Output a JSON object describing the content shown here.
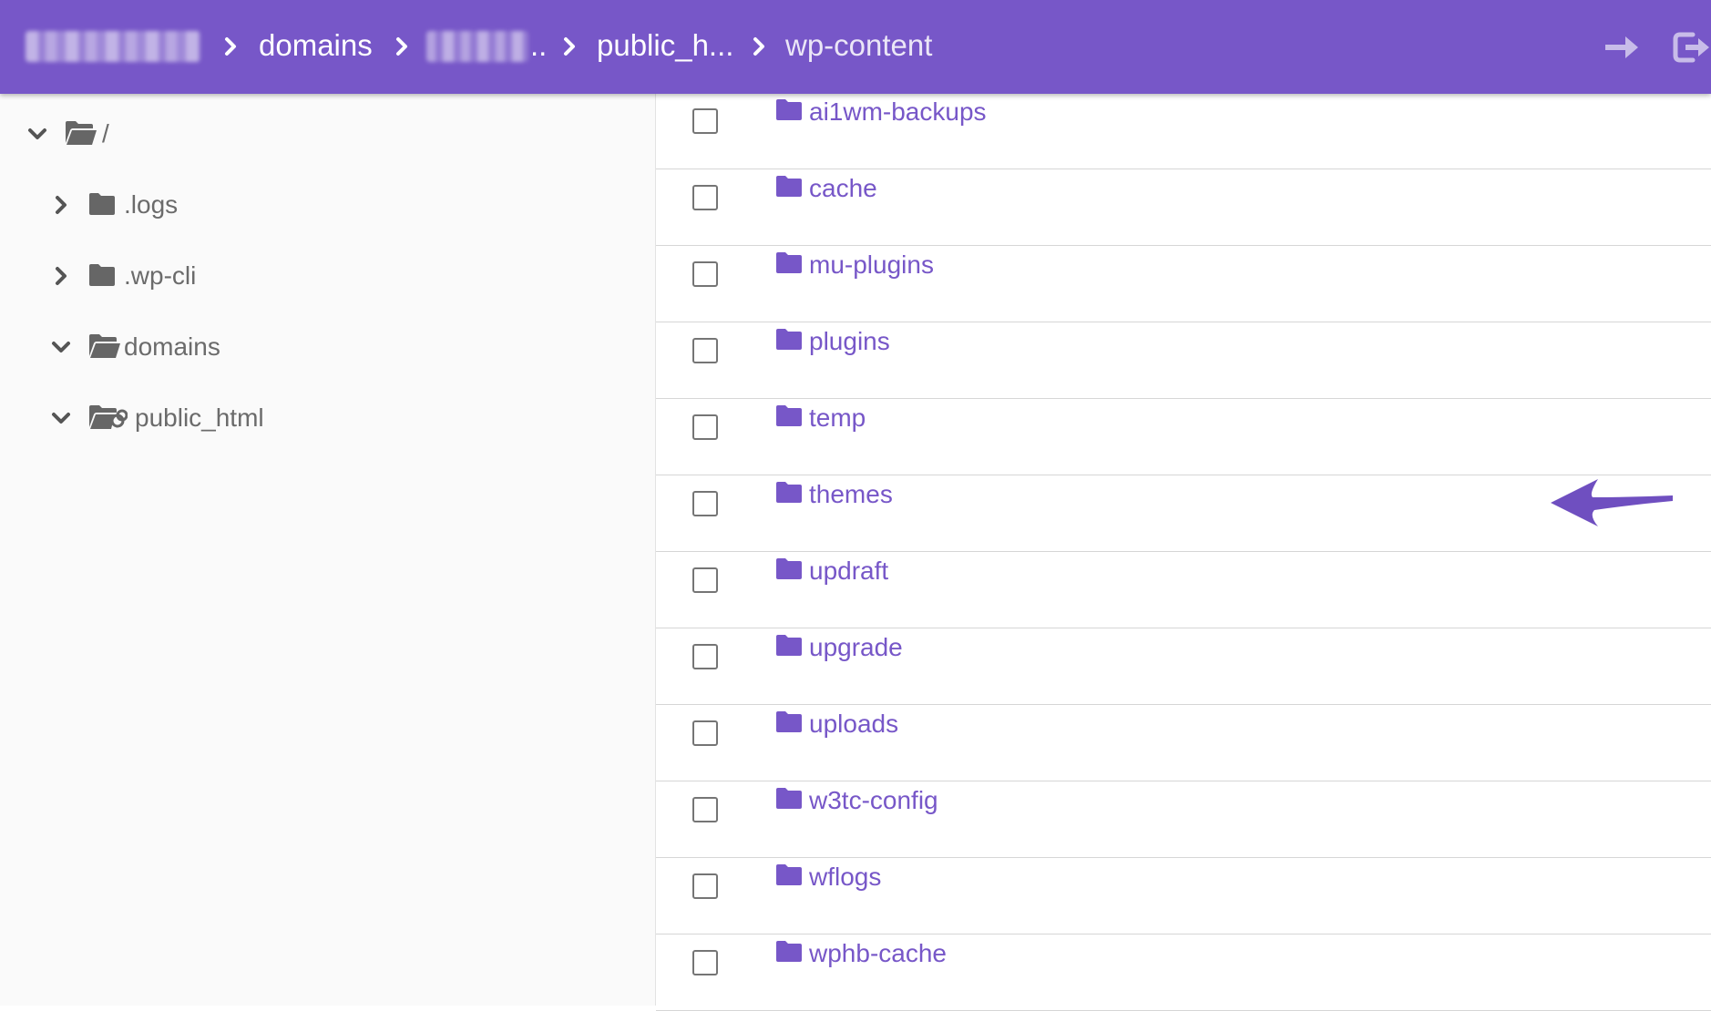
{
  "colors": {
    "header_bg": "#7757c8",
    "accent": "#7757c8",
    "sidebar_bg": "#fafafa",
    "tree_text": "#6b6b6b"
  },
  "header": {
    "breadcrumb": [
      {
        "label": "",
        "redacted": true
      },
      {
        "label": "domains"
      },
      {
        "label": "..",
        "redacted": true
      },
      {
        "label": "public_h..."
      },
      {
        "label": "wp-content",
        "current": true
      }
    ],
    "icons": [
      "arrow-right-icon",
      "logout-icon"
    ]
  },
  "sidebar": {
    "tree": [
      {
        "label": "/",
        "expanded": true,
        "icon": "folder-open-icon"
      },
      {
        "label": ".logs",
        "expanded": false,
        "icon": "folder-icon"
      },
      {
        "label": ".wp-cli",
        "expanded": false,
        "icon": "folder-icon"
      },
      {
        "label": "domains",
        "expanded": true,
        "icon": "folder-open-icon"
      },
      {
        "label": "public_html",
        "expanded": true,
        "icon": "folder-link-icon"
      }
    ]
  },
  "files": [
    {
      "name": "ai1wm-backups",
      "checked": false
    },
    {
      "name": "cache",
      "checked": false
    },
    {
      "name": "mu-plugins",
      "checked": false
    },
    {
      "name": "plugins",
      "checked": false
    },
    {
      "name": "temp",
      "checked": false,
      "highlighted": true
    },
    {
      "name": "themes",
      "checked": false
    },
    {
      "name": "updraft",
      "checked": false
    },
    {
      "name": "upgrade",
      "checked": false
    },
    {
      "name": "uploads",
      "checked": false
    },
    {
      "name": "w3tc-config",
      "checked": false
    },
    {
      "name": "wflogs",
      "checked": false
    },
    {
      "name": "wphb-cache",
      "checked": false
    }
  ]
}
